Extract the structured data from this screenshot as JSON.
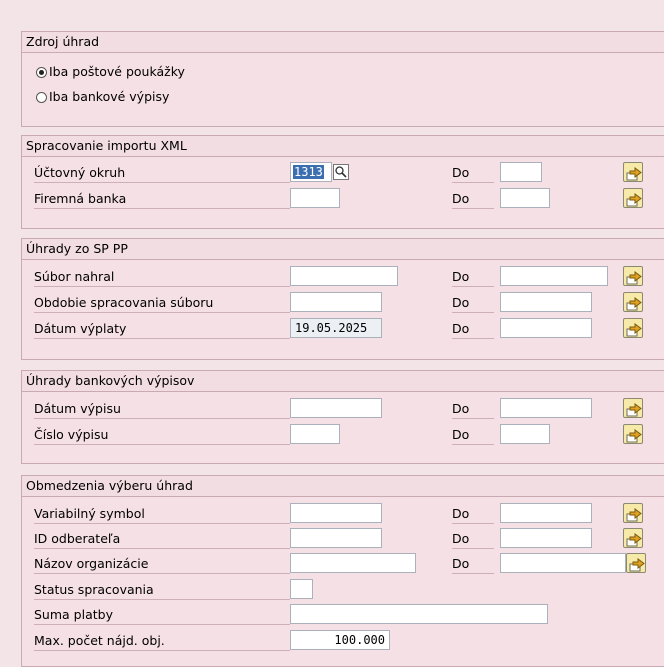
{
  "source": {
    "title": "Zdroj úhrad",
    "options": [
      {
        "label": "Iba poštové poukážky",
        "selected": true
      },
      {
        "label": "Iba bankové výpisy",
        "selected": false
      }
    ]
  },
  "xml": {
    "title": "Spracovanie importu XML",
    "rows": [
      {
        "label": "Účtovný okruh",
        "from": "1313",
        "to_label": "Do",
        "to": ""
      },
      {
        "label": "Firemná banka",
        "from": "",
        "to_label": "Do",
        "to": ""
      }
    ]
  },
  "sp": {
    "title": "Úhrady zo SP PP",
    "rows": [
      {
        "label": "Súbor nahral",
        "from": "",
        "to_label": "Do",
        "to": ""
      },
      {
        "label": "Obdobie spracovania súboru",
        "from": "",
        "to_label": "Do",
        "to": ""
      },
      {
        "label": "Dátum výplaty",
        "from": "19.05.2025",
        "to_label": "Do",
        "to": ""
      }
    ]
  },
  "bank": {
    "title": "Úhrady bankových výpisov",
    "rows": [
      {
        "label": "Dátum výpisu",
        "from": "",
        "to_label": "Do",
        "to": ""
      },
      {
        "label": "Číslo výpisu",
        "from": "",
        "to_label": "Do",
        "to": ""
      }
    ]
  },
  "limits": {
    "title": "Obmedzenia výberu úhrad",
    "rows": [
      {
        "label": "Variabilný symbol",
        "from": "",
        "to_label": "Do",
        "to": ""
      },
      {
        "label": "ID odberateľa",
        "from": "",
        "to_label": "Do",
        "to": ""
      },
      {
        "label": "Názov organizácie",
        "from": "",
        "to_label": "Do",
        "to": ""
      },
      {
        "label": "Status spracovania",
        "value": ""
      },
      {
        "label": "Suma platby",
        "value": ""
      },
      {
        "label": "Max. počet nájd. obj.",
        "value": "100.000"
      }
    ]
  },
  "colors": {
    "multiple_selection_icon": "#f7e9a8",
    "selected_text": "#3b6fb0"
  }
}
